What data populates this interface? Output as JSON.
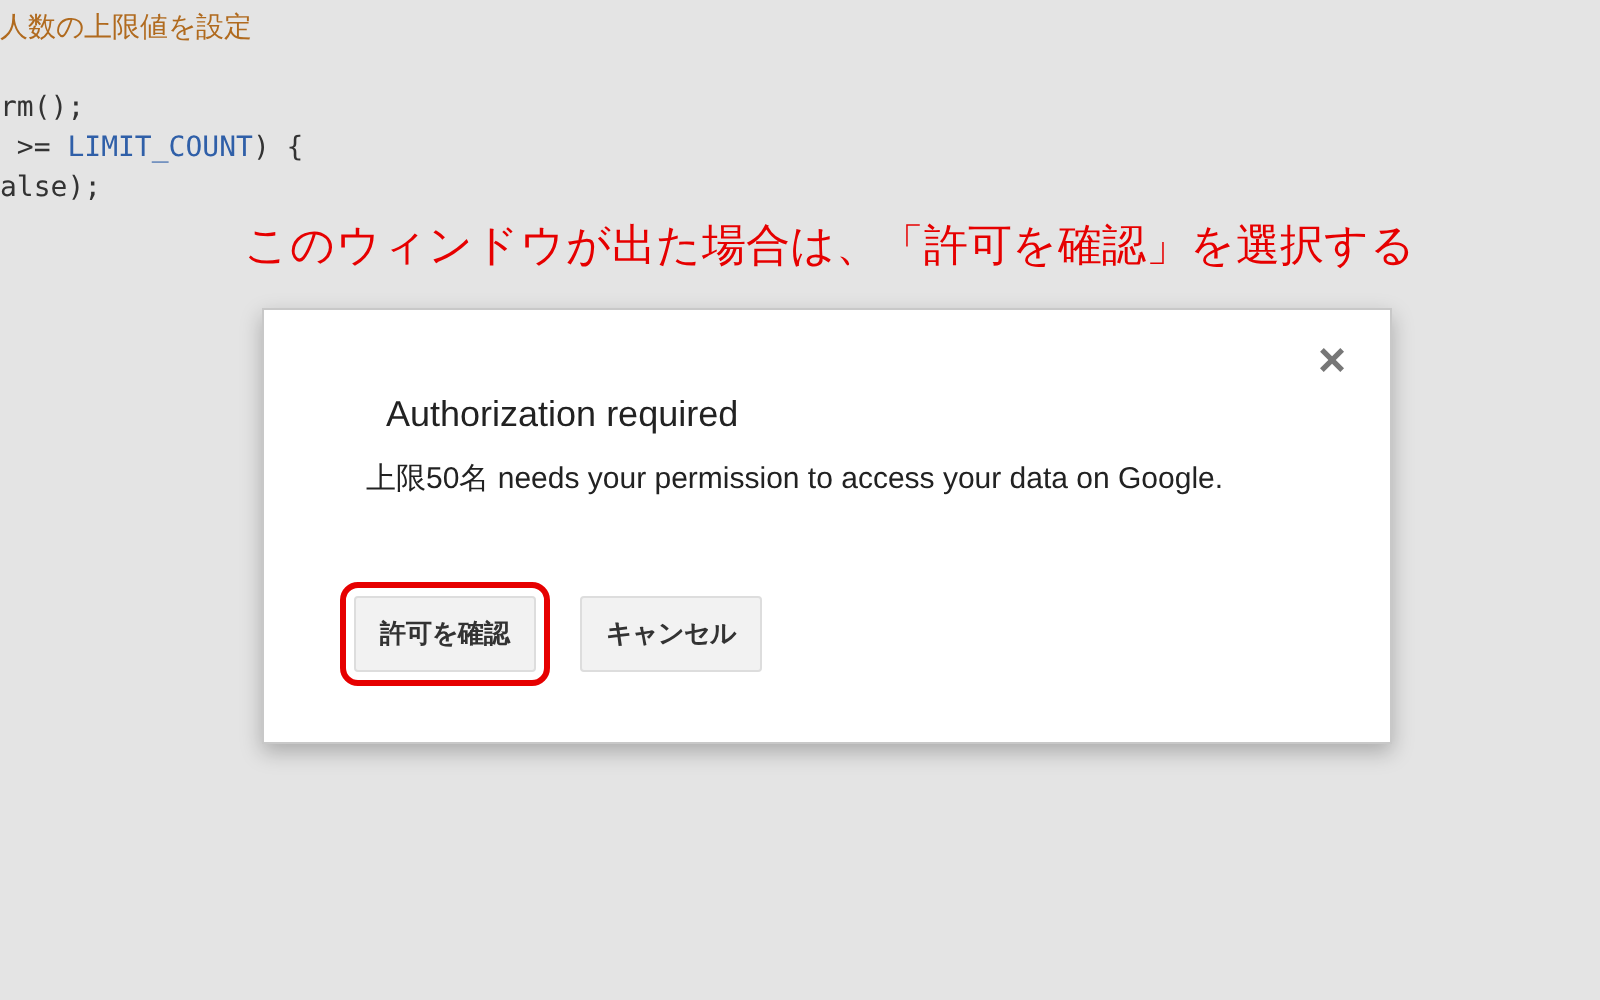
{
  "code_lines": [
    [
      {
        "kind": "comment",
        "text": "人数の上限値を設定"
      }
    ],
    [
      {
        "kind": "plain",
        "text": "rm();"
      }
    ],
    [
      {
        "kind": "plain",
        "text": " >= "
      },
      {
        "kind": "constant",
        "text": "LIMIT_COUNT"
      },
      {
        "kind": "plain",
        "text": ") {"
      }
    ],
    [
      {
        "kind": "plain",
        "text": "alse);"
      }
    ]
  ],
  "annotation": "このウィンドウが出た場合は、「許可を確認」を選択する",
  "dialog": {
    "close": "×",
    "title": "Authorization required",
    "message": "上限50名 needs your permission to access your data on Google.",
    "buttons": [
      {
        "label": "許可を確認",
        "highlighted": true
      },
      {
        "label": "キャンセル",
        "highlighted": false
      }
    ]
  }
}
